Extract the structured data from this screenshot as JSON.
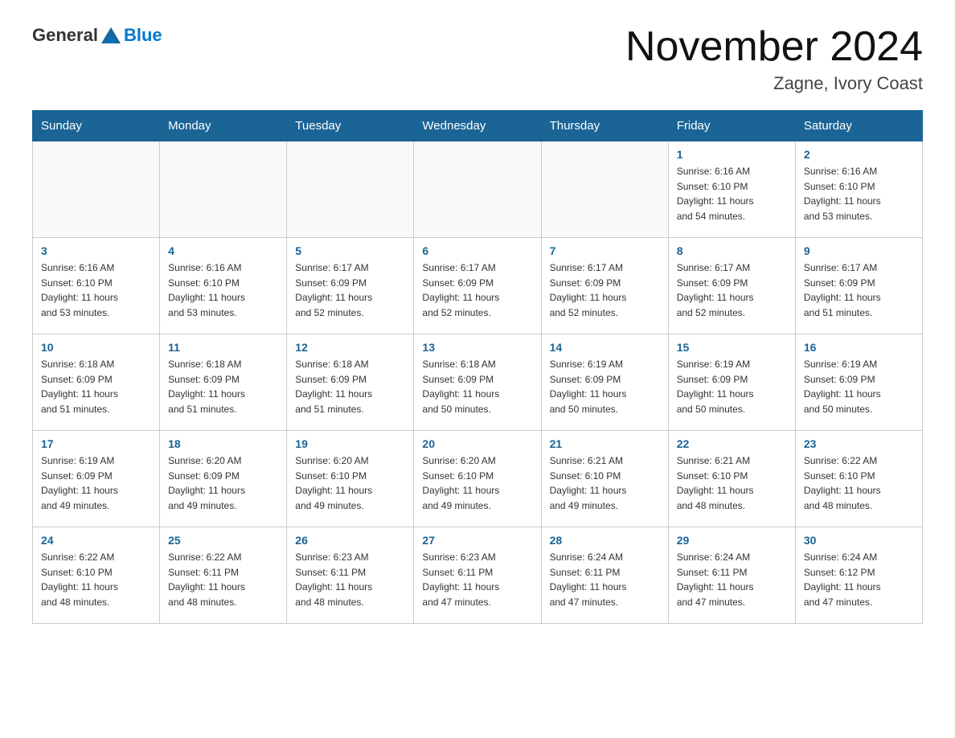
{
  "header": {
    "logo_general": "General",
    "logo_blue": "Blue",
    "month_year": "November 2024",
    "location": "Zagne, Ivory Coast"
  },
  "weekdays": [
    "Sunday",
    "Monday",
    "Tuesday",
    "Wednesday",
    "Thursday",
    "Friday",
    "Saturday"
  ],
  "weeks": [
    [
      {
        "day": "",
        "info": ""
      },
      {
        "day": "",
        "info": ""
      },
      {
        "day": "",
        "info": ""
      },
      {
        "day": "",
        "info": ""
      },
      {
        "day": "",
        "info": ""
      },
      {
        "day": "1",
        "info": "Sunrise: 6:16 AM\nSunset: 6:10 PM\nDaylight: 11 hours\nand 54 minutes."
      },
      {
        "day": "2",
        "info": "Sunrise: 6:16 AM\nSunset: 6:10 PM\nDaylight: 11 hours\nand 53 minutes."
      }
    ],
    [
      {
        "day": "3",
        "info": "Sunrise: 6:16 AM\nSunset: 6:10 PM\nDaylight: 11 hours\nand 53 minutes."
      },
      {
        "day": "4",
        "info": "Sunrise: 6:16 AM\nSunset: 6:10 PM\nDaylight: 11 hours\nand 53 minutes."
      },
      {
        "day": "5",
        "info": "Sunrise: 6:17 AM\nSunset: 6:09 PM\nDaylight: 11 hours\nand 52 minutes."
      },
      {
        "day": "6",
        "info": "Sunrise: 6:17 AM\nSunset: 6:09 PM\nDaylight: 11 hours\nand 52 minutes."
      },
      {
        "day": "7",
        "info": "Sunrise: 6:17 AM\nSunset: 6:09 PM\nDaylight: 11 hours\nand 52 minutes."
      },
      {
        "day": "8",
        "info": "Sunrise: 6:17 AM\nSunset: 6:09 PM\nDaylight: 11 hours\nand 52 minutes."
      },
      {
        "day": "9",
        "info": "Sunrise: 6:17 AM\nSunset: 6:09 PM\nDaylight: 11 hours\nand 51 minutes."
      }
    ],
    [
      {
        "day": "10",
        "info": "Sunrise: 6:18 AM\nSunset: 6:09 PM\nDaylight: 11 hours\nand 51 minutes."
      },
      {
        "day": "11",
        "info": "Sunrise: 6:18 AM\nSunset: 6:09 PM\nDaylight: 11 hours\nand 51 minutes."
      },
      {
        "day": "12",
        "info": "Sunrise: 6:18 AM\nSunset: 6:09 PM\nDaylight: 11 hours\nand 51 minutes."
      },
      {
        "day": "13",
        "info": "Sunrise: 6:18 AM\nSunset: 6:09 PM\nDaylight: 11 hours\nand 50 minutes."
      },
      {
        "day": "14",
        "info": "Sunrise: 6:19 AM\nSunset: 6:09 PM\nDaylight: 11 hours\nand 50 minutes."
      },
      {
        "day": "15",
        "info": "Sunrise: 6:19 AM\nSunset: 6:09 PM\nDaylight: 11 hours\nand 50 minutes."
      },
      {
        "day": "16",
        "info": "Sunrise: 6:19 AM\nSunset: 6:09 PM\nDaylight: 11 hours\nand 50 minutes."
      }
    ],
    [
      {
        "day": "17",
        "info": "Sunrise: 6:19 AM\nSunset: 6:09 PM\nDaylight: 11 hours\nand 49 minutes."
      },
      {
        "day": "18",
        "info": "Sunrise: 6:20 AM\nSunset: 6:09 PM\nDaylight: 11 hours\nand 49 minutes."
      },
      {
        "day": "19",
        "info": "Sunrise: 6:20 AM\nSunset: 6:10 PM\nDaylight: 11 hours\nand 49 minutes."
      },
      {
        "day": "20",
        "info": "Sunrise: 6:20 AM\nSunset: 6:10 PM\nDaylight: 11 hours\nand 49 minutes."
      },
      {
        "day": "21",
        "info": "Sunrise: 6:21 AM\nSunset: 6:10 PM\nDaylight: 11 hours\nand 49 minutes."
      },
      {
        "day": "22",
        "info": "Sunrise: 6:21 AM\nSunset: 6:10 PM\nDaylight: 11 hours\nand 48 minutes."
      },
      {
        "day": "23",
        "info": "Sunrise: 6:22 AM\nSunset: 6:10 PM\nDaylight: 11 hours\nand 48 minutes."
      }
    ],
    [
      {
        "day": "24",
        "info": "Sunrise: 6:22 AM\nSunset: 6:10 PM\nDaylight: 11 hours\nand 48 minutes."
      },
      {
        "day": "25",
        "info": "Sunrise: 6:22 AM\nSunset: 6:11 PM\nDaylight: 11 hours\nand 48 minutes."
      },
      {
        "day": "26",
        "info": "Sunrise: 6:23 AM\nSunset: 6:11 PM\nDaylight: 11 hours\nand 48 minutes."
      },
      {
        "day": "27",
        "info": "Sunrise: 6:23 AM\nSunset: 6:11 PM\nDaylight: 11 hours\nand 47 minutes."
      },
      {
        "day": "28",
        "info": "Sunrise: 6:24 AM\nSunset: 6:11 PM\nDaylight: 11 hours\nand 47 minutes."
      },
      {
        "day": "29",
        "info": "Sunrise: 6:24 AM\nSunset: 6:11 PM\nDaylight: 11 hours\nand 47 minutes."
      },
      {
        "day": "30",
        "info": "Sunrise: 6:24 AM\nSunset: 6:12 PM\nDaylight: 11 hours\nand 47 minutes."
      }
    ]
  ]
}
